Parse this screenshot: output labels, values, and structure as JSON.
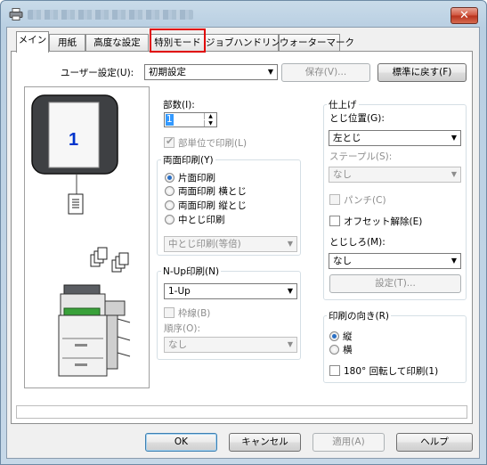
{
  "window": {
    "close_label": "✕"
  },
  "tabs": [
    {
      "label": "メイン",
      "active": true
    },
    {
      "label": "用紙"
    },
    {
      "label": "高度な設定"
    },
    {
      "label": "特別モード"
    },
    {
      "label": "ジョブハンドリング"
    },
    {
      "label": "ウォーターマーク"
    }
  ],
  "user_settings": {
    "label": "ユーザー設定(U):",
    "value": "初期設定",
    "save_button": "保存(V)...",
    "default_button": "標準に戻す(F)"
  },
  "preview": {
    "page_number": "1"
  },
  "copies": {
    "label": "部数(I):",
    "value": "1",
    "collate_label": "部単位で印刷(L)"
  },
  "duplex": {
    "title": "両面印刷(Y)",
    "options": [
      "片面印刷",
      "両面印刷 横とじ",
      "両面印刷 縦とじ",
      "中とじ印刷"
    ],
    "selected_index": 0,
    "booklet_value": "中とじ印刷(等倍)"
  },
  "nup": {
    "title": "N-Up印刷(N)",
    "value": "1-Up",
    "border_label": "枠線(B)",
    "order_label": "順序(O):",
    "order_value": "なし"
  },
  "finishing": {
    "title": "仕上げ",
    "binding_position_label": "とじ位置(G):",
    "binding_position_value": "左とじ",
    "staple_label": "ステープル(S):",
    "staple_value": "なし",
    "punch_label": "パンチ(C)",
    "offset_label": "オフセット解除(E)",
    "margin_label": "とじしろ(M):",
    "margin_value": "なし",
    "settings_button": "設定(T)..."
  },
  "orientation": {
    "title": "印刷の向き(R)",
    "options": [
      "縦",
      "横"
    ],
    "selected_index": 0,
    "rotate_label": "180° 回転して印刷(1)"
  },
  "footer": {
    "ok": "OK",
    "cancel": "キャンセル",
    "apply": "適用(A)",
    "help": "ヘルプ"
  }
}
